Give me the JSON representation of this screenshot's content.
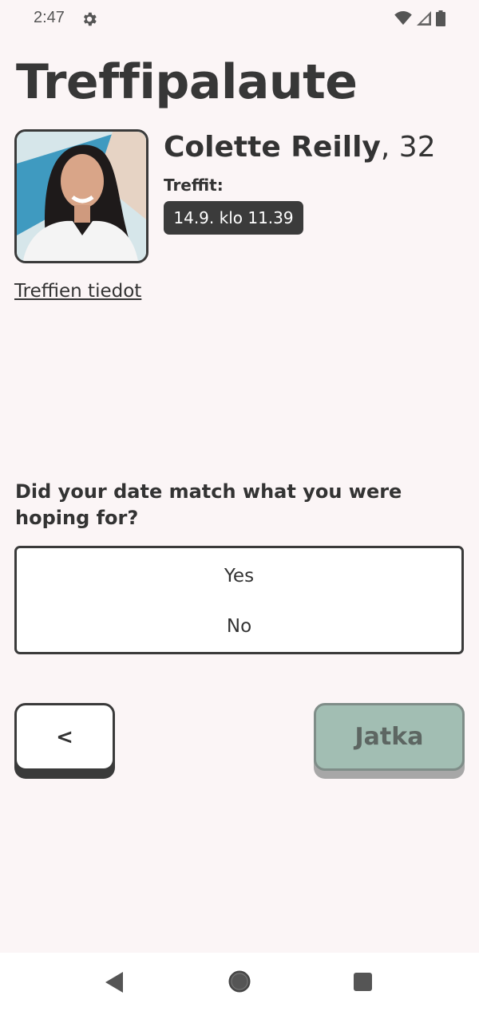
{
  "status_bar": {
    "time": "2:47",
    "icons": [
      "settings-gear-icon",
      "wifi-icon",
      "signal-icon",
      "battery-icon"
    ]
  },
  "page": {
    "title": "Treffipalaute"
  },
  "profile": {
    "name": "Colette Reilly",
    "age_text": ", 32",
    "dates_label": "Treffit:",
    "date_chip": "14.9. klo 11.39",
    "details_link": "Treffien tiedot"
  },
  "question": {
    "text": "Did your date match what you were hoping for?",
    "options": [
      "Yes",
      "No"
    ]
  },
  "buttons": {
    "back_label": "<",
    "next_label": "Jatka"
  },
  "nav_bar": {
    "icons": [
      "back-triangle-icon",
      "home-circle-icon",
      "recents-square-icon"
    ]
  },
  "colors": {
    "background": "#fbf5f6",
    "dark": "#3a3a3a",
    "next_button_fill": "#a2beb3",
    "next_button_text": "#5d6662"
  }
}
